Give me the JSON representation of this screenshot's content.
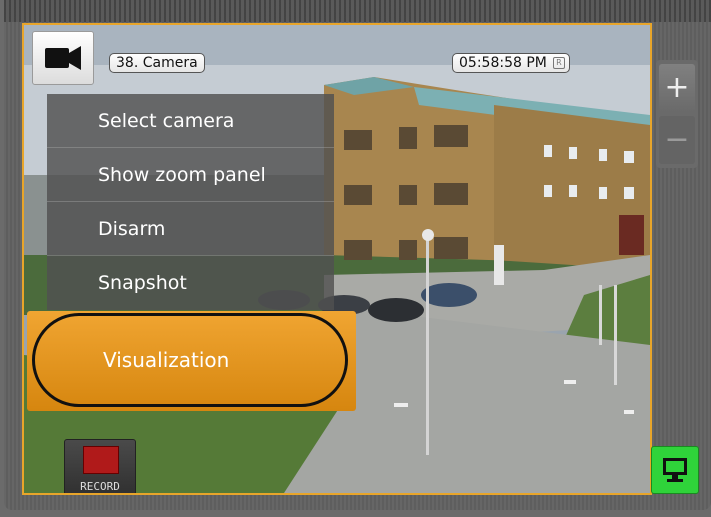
{
  "camera": {
    "name": "38. Camera",
    "time": "05:58:58 PM",
    "time_indicator": "R"
  },
  "menu": {
    "items": [
      {
        "label": "Select camera"
      },
      {
        "label": "Show zoom panel"
      },
      {
        "label": "Disarm"
      },
      {
        "label": "Snapshot"
      }
    ],
    "highlighted": {
      "label": "Visualization"
    }
  },
  "record": {
    "label": "RECORD"
  },
  "zoom": {
    "in_label": "+",
    "out_label": "−"
  },
  "colors": {
    "accent": "#e8a52a",
    "monitor": "#2fd33a"
  }
}
